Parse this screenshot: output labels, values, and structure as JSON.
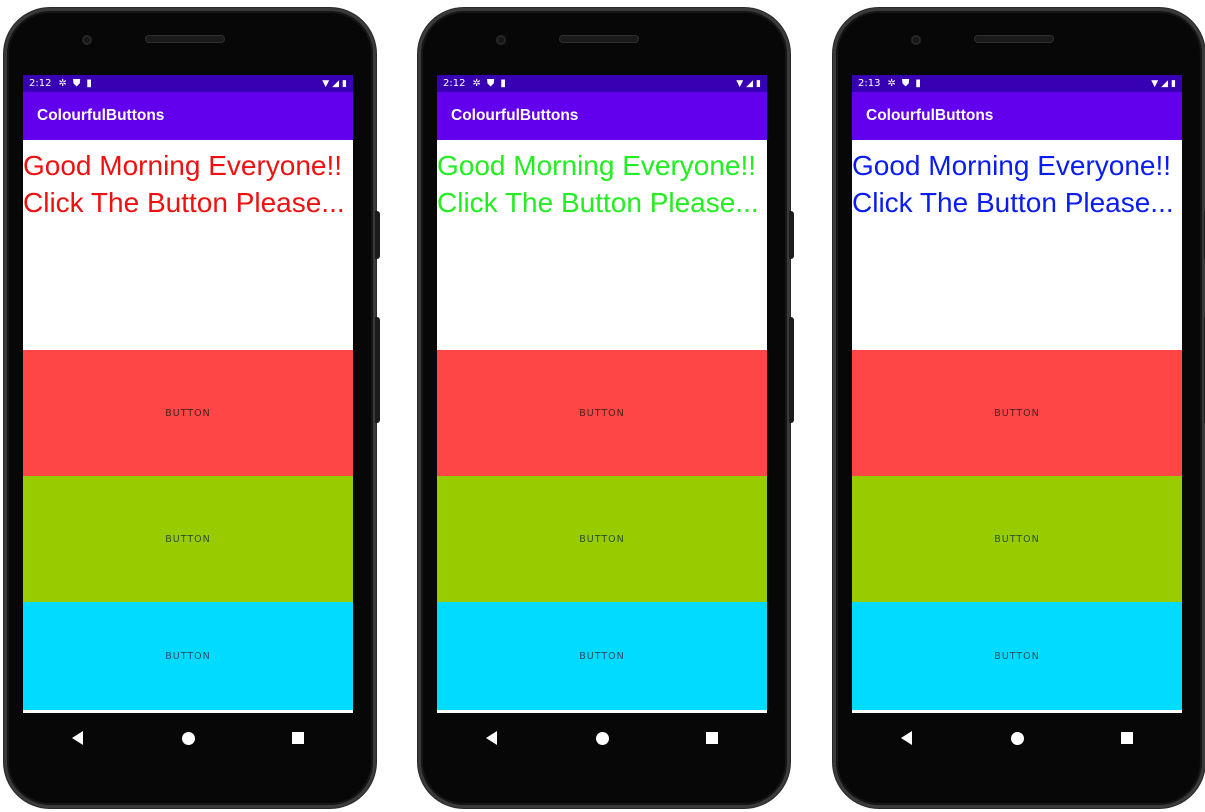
{
  "colors": {
    "status_bar": "#3700b3",
    "app_bar": "#6200ee",
    "button_red": "#ff4646",
    "button_green": "#99cc00",
    "button_cyan": "#00dbff",
    "greeting_red": "#ee1111",
    "greeting_green": "#22ee22",
    "greeting_blue": "#0a1cee"
  },
  "phones": [
    {
      "status_time": "2:12",
      "app_title": "ColourfulButtons",
      "greeting": "Good Morning Everyone!! Click The Button Please...",
      "greeting_color": "#ee1111",
      "buttons": [
        {
          "label": "BUTTON",
          "color": "#ff4646"
        },
        {
          "label": "BUTTON",
          "color": "#99cc00"
        },
        {
          "label": "BUTTON",
          "color": "#00dbff"
        }
      ]
    },
    {
      "status_time": "2:12",
      "app_title": "ColourfulButtons",
      "greeting": "Good Morning Everyone!! Click The Button Please...",
      "greeting_color": "#22ee22",
      "buttons": [
        {
          "label": "BUTTON",
          "color": "#ff4646"
        },
        {
          "label": "BUTTON",
          "color": "#99cc00"
        },
        {
          "label": "BUTTON",
          "color": "#00dbff"
        }
      ]
    },
    {
      "status_time": "2:13",
      "app_title": "ColourfulButtons",
      "greeting": "Good Morning Everyone!! Click The Button Please...",
      "greeting_color": "#0a1cee",
      "buttons": [
        {
          "label": "BUTTON",
          "color": "#ff4646"
        },
        {
          "label": "BUTTON",
          "color": "#99cc00"
        },
        {
          "label": "BUTTON",
          "color": "#00dbff"
        }
      ]
    }
  ],
  "icons": {
    "status_left": [
      "gear-icon",
      "shield-icon",
      "sd-card-icon"
    ],
    "status_right": [
      "wifi-icon",
      "signal-icon",
      "battery-icon"
    ],
    "nav": [
      "back-icon",
      "home-icon",
      "recents-icon"
    ]
  }
}
